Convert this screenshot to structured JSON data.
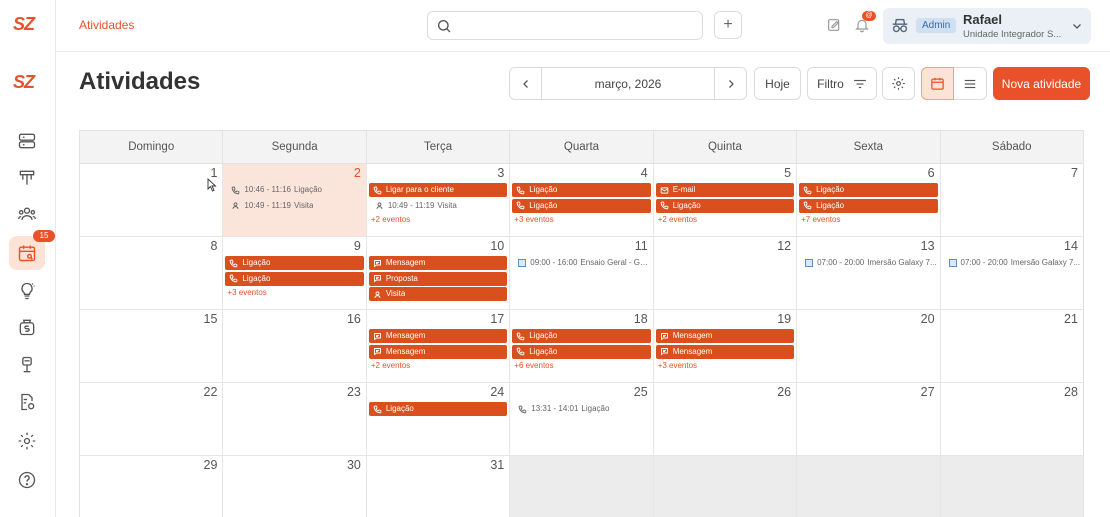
{
  "brand": {
    "logo_text": "SZ",
    "accent": "#e8512a",
    "event_color": "#d94f1e"
  },
  "topbar": {
    "breadcrumb": "Atividades",
    "search": {
      "placeholder": "",
      "value": ""
    },
    "notification_badge": "@",
    "user": {
      "role": "Admin",
      "name": "Rafael",
      "unit": "Unidade Integrador S..."
    }
  },
  "sidebar": {
    "items": [
      {
        "name": "server-icon"
      },
      {
        "name": "funnel-icon"
      },
      {
        "name": "users-icon"
      },
      {
        "name": "calendar-icon",
        "active": true,
        "badge": "15"
      },
      {
        "name": "lightbulb-icon"
      },
      {
        "name": "money-bag-icon"
      },
      {
        "name": "plant-icon"
      },
      {
        "name": "document-settings-icon"
      },
      {
        "name": "gear-icon"
      },
      {
        "name": "help-icon"
      }
    ]
  },
  "header": {
    "title": "Atividades",
    "month_label": "março, 2026",
    "today_label": "Hoje",
    "filter_label": "Filtro",
    "new_activity_label": "Nova atividade"
  },
  "calendar": {
    "weekdays": [
      "Domingo",
      "Segunda",
      "Terça",
      "Quarta",
      "Quinta",
      "Sexta",
      "Sábado"
    ],
    "weeks": [
      [
        {
          "day": "1",
          "events": []
        },
        {
          "day": "2",
          "today": true,
          "events": [
            {
              "style": "plain",
              "icon": "phone",
              "time": "10:46 - 11:16",
              "label": "Ligação"
            },
            {
              "style": "plain",
              "icon": "visit",
              "time": "10:49 - 11:19",
              "label": "Visita"
            }
          ]
        },
        {
          "day": "3",
          "events": [
            {
              "style": "block",
              "icon": "phone",
              "label": "Ligar para o cliente"
            },
            {
              "style": "plain",
              "icon": "visit",
              "time": "10:49 - 11:19",
              "label": "Visita"
            }
          ],
          "more": "+2 eventos"
        },
        {
          "day": "4",
          "events": [
            {
              "style": "block",
              "icon": "phone",
              "label": "Ligação"
            },
            {
              "style": "block",
              "icon": "phone",
              "label": "Ligação"
            }
          ],
          "more": "+3 eventos"
        },
        {
          "day": "5",
          "events": [
            {
              "style": "block",
              "icon": "mail",
              "label": "E-mail"
            },
            {
              "style": "block",
              "icon": "phone",
              "label": "Ligação"
            }
          ],
          "more": "+2 eventos"
        },
        {
          "day": "6",
          "events": [
            {
              "style": "block",
              "icon": "phone",
              "label": "Ligação"
            },
            {
              "style": "block",
              "icon": "phone",
              "label": "Ligação"
            }
          ],
          "more": "+7 eventos"
        },
        {
          "day": "7",
          "events": []
        }
      ],
      [
        {
          "day": "8",
          "events": []
        },
        {
          "day": "9",
          "events": [
            {
              "style": "block",
              "icon": "phone",
              "label": "Ligação"
            },
            {
              "style": "block",
              "icon": "phone",
              "label": "Ligação"
            }
          ],
          "more": "+3 eventos"
        },
        {
          "day": "10",
          "events": [
            {
              "style": "block",
              "icon": "message",
              "label": "Mensagem"
            },
            {
              "style": "block",
              "icon": "message",
              "label": "Proposta"
            },
            {
              "style": "block",
              "icon": "visit",
              "label": "Visita"
            }
          ]
        },
        {
          "day": "11",
          "events": [
            {
              "style": "plain",
              "icon": "calendar",
              "time": "09:00 - 16:00",
              "label": "Ensaio Geral - Ga..."
            }
          ]
        },
        {
          "day": "12",
          "events": []
        },
        {
          "day": "13",
          "events": [
            {
              "style": "plain",
              "icon": "calendar",
              "time": "07:00 - 20:00",
              "label": "Imersão Galaxy 7..."
            }
          ]
        },
        {
          "day": "14",
          "events": [
            {
              "style": "plain",
              "icon": "calendar",
              "time": "07:00 - 20:00",
              "label": "Imersão Galaxy 7..."
            }
          ]
        }
      ],
      [
        {
          "day": "15",
          "events": []
        },
        {
          "day": "16",
          "events": []
        },
        {
          "day": "17",
          "events": [
            {
              "style": "block",
              "icon": "message",
              "label": "Mensagem"
            },
            {
              "style": "block",
              "icon": "message",
              "label": "Mensagem"
            }
          ],
          "more": "+2 eventos"
        },
        {
          "day": "18",
          "events": [
            {
              "style": "block",
              "icon": "phone",
              "label": "Ligação"
            },
            {
              "style": "block",
              "icon": "phone",
              "label": "Ligação"
            }
          ],
          "more": "+6 eventos"
        },
        {
          "day": "19",
          "events": [
            {
              "style": "block",
              "icon": "message",
              "label": "Mensagem"
            },
            {
              "style": "block",
              "icon": "message",
              "label": "Mensagem"
            }
          ],
          "more": "+3 eventos"
        },
        {
          "day": "20",
          "events": []
        },
        {
          "day": "21",
          "events": []
        }
      ],
      [
        {
          "day": "22",
          "events": []
        },
        {
          "day": "23",
          "events": []
        },
        {
          "day": "24",
          "events": [
            {
              "style": "block",
              "icon": "phone",
              "label": "Ligação"
            }
          ]
        },
        {
          "day": "25",
          "events": [
            {
              "style": "plain",
              "icon": "phone",
              "time": "13:31 - 14:01",
              "label": "Ligação"
            }
          ]
        },
        {
          "day": "26",
          "events": []
        },
        {
          "day": "27",
          "events": []
        },
        {
          "day": "28",
          "events": []
        }
      ],
      [
        {
          "day": "29",
          "events": []
        },
        {
          "day": "30",
          "events": []
        },
        {
          "day": "31",
          "events": []
        },
        {
          "day": "",
          "outside": true,
          "events": []
        },
        {
          "day": "",
          "outside": true,
          "events": []
        },
        {
          "day": "",
          "outside": true,
          "events": []
        },
        {
          "day": "",
          "outside": true,
          "events": []
        }
      ]
    ]
  }
}
